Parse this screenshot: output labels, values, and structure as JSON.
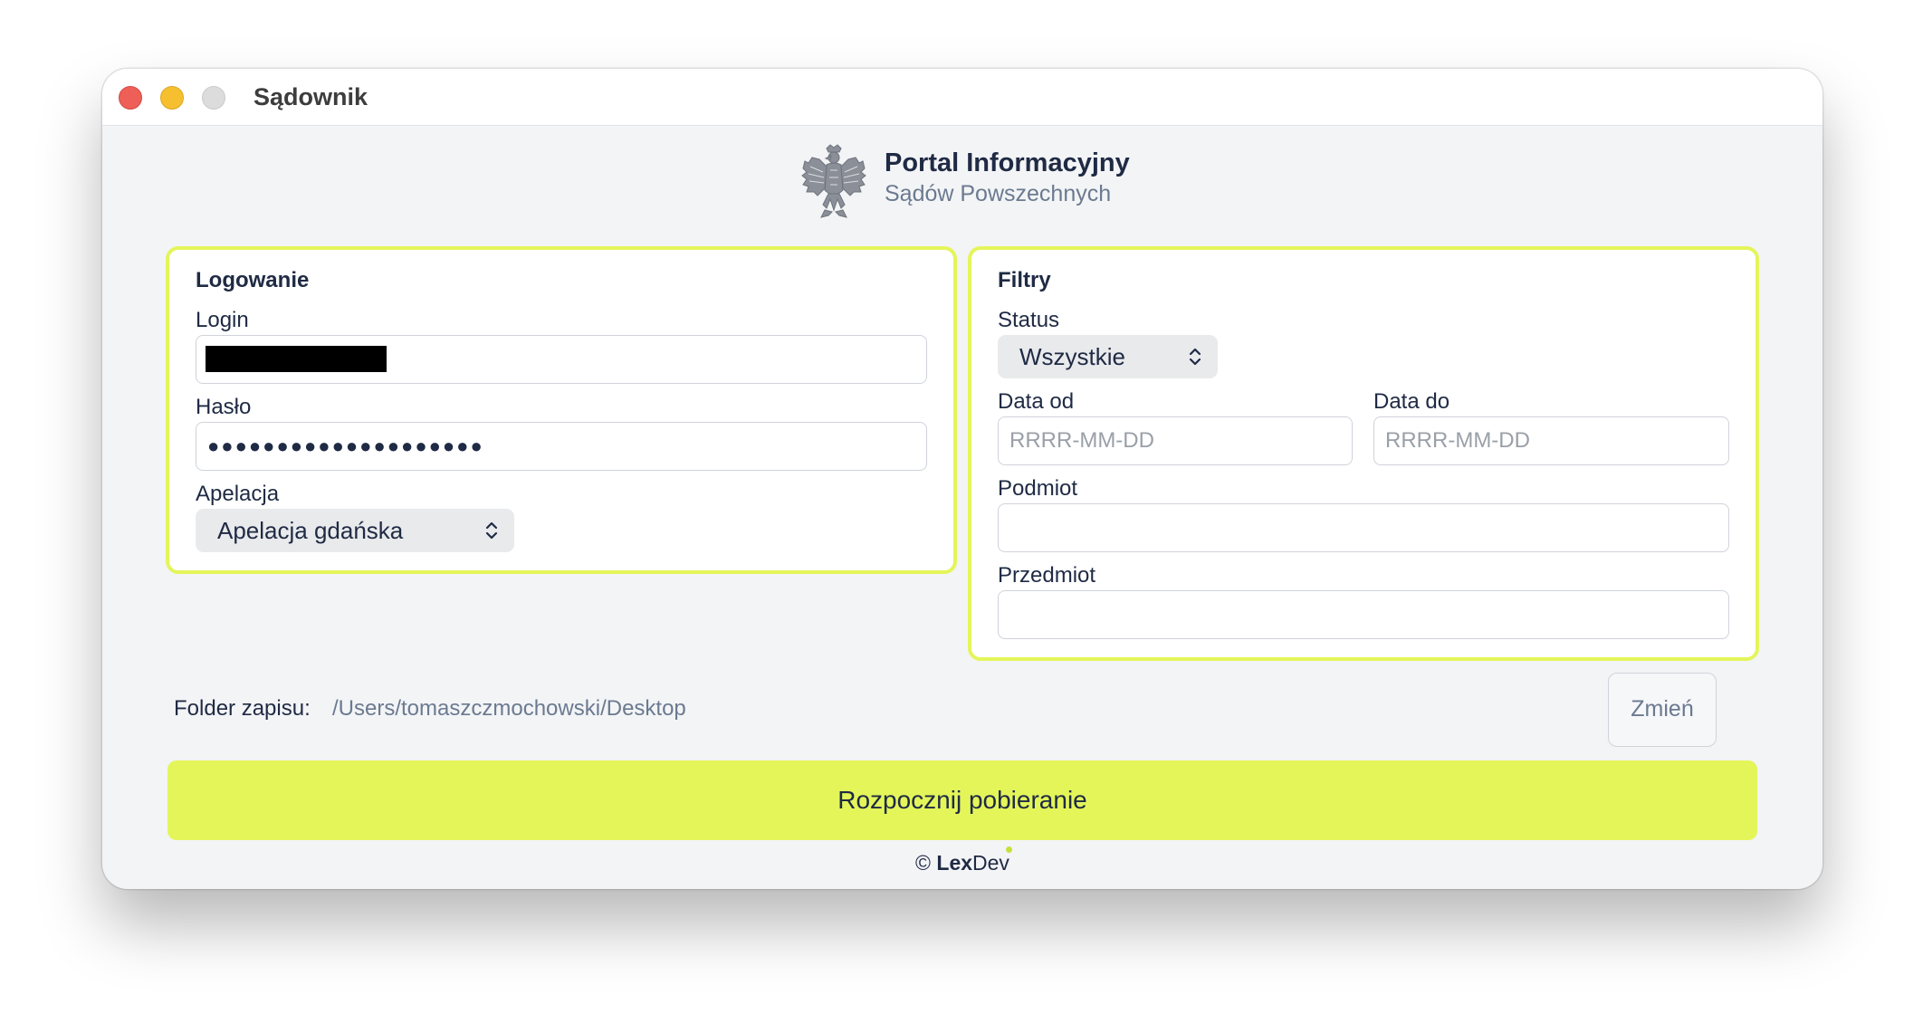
{
  "window": {
    "title": "Sądownik"
  },
  "header": {
    "title": "Portal Informacyjny",
    "subtitle": "Sądów Powszechnych"
  },
  "login_panel": {
    "title": "Logowanie",
    "login_label": "Login",
    "login_value": "",
    "password_label": "Hasło",
    "password_value": "●●●●●●●●●●●●●●●●●●●●",
    "appellation_label": "Apelacja",
    "appellation_selected": "Apelacja gdańska"
  },
  "filters_panel": {
    "title": "Filtry",
    "status_label": "Status",
    "status_selected": "Wszystkie",
    "date_from_label": "Data od",
    "date_from_placeholder": "RRRR-MM-DD",
    "date_to_label": "Data do",
    "date_to_placeholder": "RRRR-MM-DD",
    "subject_label": "Podmiot",
    "matter_label": "Przedmiot"
  },
  "save_folder": {
    "label": "Folder zapisu:",
    "path": "/Users/tomaszczmochowski/Desktop",
    "change_label": "Zmień"
  },
  "start_button": "Rozpocznij pobieranie",
  "footer": {
    "copyright": "©",
    "brand_bold": "Lex",
    "brand_rest": "Dev"
  },
  "colors": {
    "accent": "#e4f55a",
    "text": "#1f2a44",
    "muted": "#6b7a90",
    "close": "#ee5f57",
    "minimize": "#f5bf2f",
    "maximize": "#dcdcdc"
  },
  "icons": {
    "logo": "polish-eagle-emblem",
    "select": "chevron-up-down-icon"
  }
}
